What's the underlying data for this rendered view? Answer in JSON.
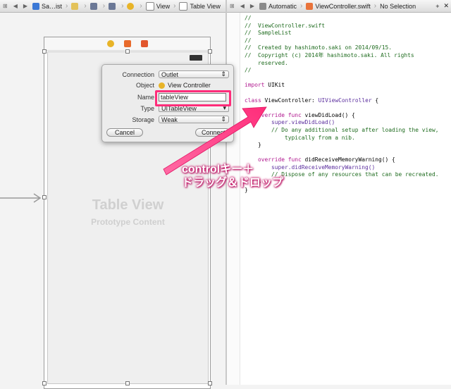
{
  "left_jumpbar": {
    "nav_back": "◀",
    "nav_forward": "▶",
    "items": [
      "Sa…ist",
      "",
      "",
      "",
      "",
      "View",
      "Table View"
    ]
  },
  "right_jumpbar": {
    "nav_back": "◀",
    "nav_forward": "▶",
    "items": [
      "Automatic",
      "ViewController.swift",
      "No Selection"
    ],
    "plus": "+",
    "close": "✕"
  },
  "popover": {
    "connection_label": "Connection",
    "connection_value": "Outlet",
    "object_label": "Object",
    "object_value": "View Controller",
    "name_label": "Name",
    "name_value": "tableView",
    "type_label": "Type",
    "type_value": "UITableView",
    "storage_label": "Storage",
    "storage_value": "Weak",
    "cancel_label": "Cancel",
    "connect_label": "Connect"
  },
  "scene": {
    "table_title": "Table View",
    "table_subtitle": "Prototype Content"
  },
  "annotation": {
    "line1": "controlキー＋",
    "line2": "ドラッグ＆ドロップ"
  },
  "code": {
    "header": [
      "//",
      "//  ViewController.swift",
      "//  SampleList",
      "//",
      "//  Created by hashimoto.saki on 2014/09/15.",
      "//  Copyright (c) 2014年 hashimoto.saki. All rights",
      "    reserved.",
      "//"
    ],
    "import_kw": "import",
    "import_mod": "UIKit",
    "class_kw": "class",
    "class_name": "ViewController:",
    "class_super": "UIViewController",
    "brace_open": "{",
    "override1_kw": "override func",
    "override1_sig": "viewDidLoad() {",
    "super1": "super.viewDidLoad()",
    "comment1a": "// Do any additional setup after loading the view,",
    "comment1b": "    typically from a nib.",
    "close1": "}",
    "override2_kw": "override func",
    "override2_sig": "didReceiveMemoryWarning() {",
    "super2": "super.didReceiveMemoryWarning()",
    "comment2": "// Dispose of any resources that can be recreated.",
    "close2": "}",
    "brace_close": "}"
  },
  "colors": {
    "accent": "#ff2d7a",
    "comment": "#1e6b1e",
    "keyword": "#b0168e",
    "type": "#5b2e9e"
  }
}
